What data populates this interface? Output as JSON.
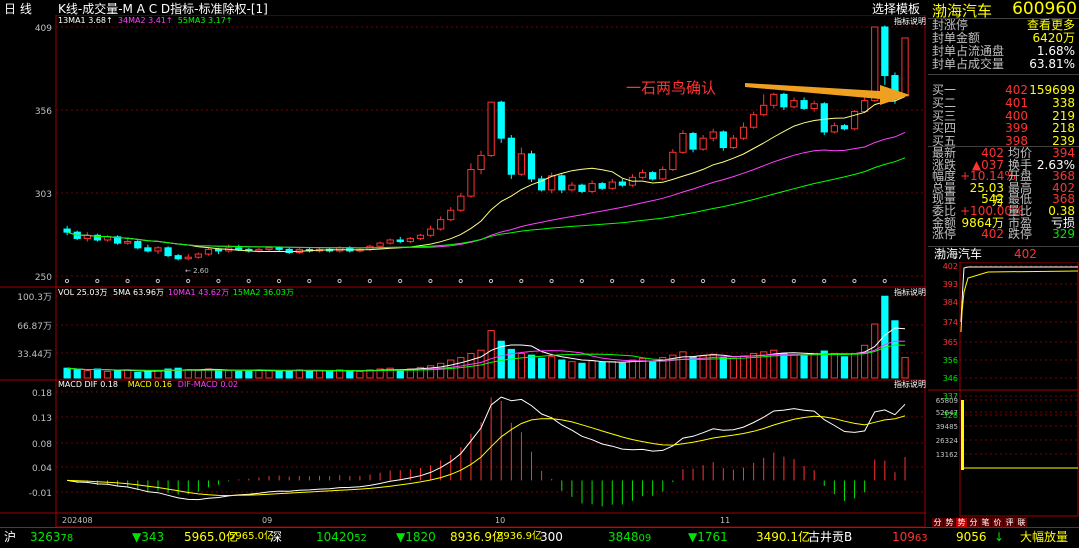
{
  "header": {
    "period": "日  线",
    "subtitle": "K线-成交量-M A C D指标-标准除权-[1]",
    "template_button": "选择模板"
  },
  "kline_panel": {
    "ma_legend": [
      {
        "label": "13MA1 3.68↑",
        "color": "#ffffff"
      },
      {
        "label": "34MA2 3.41↑",
        "color": "#ff40ff"
      },
      {
        "label": "55MA3 3.17↑",
        "color": "#00ff00"
      }
    ],
    "indicator_help": "指标说明",
    "y_labels": [
      "409",
      "356",
      "303",
      "250"
    ],
    "annotation": "一石两鸟确认",
    "low_label": "2.60"
  },
  "volume_panel": {
    "legend": [
      {
        "label": "VOL 25.03万",
        "color": "#ffffff"
      },
      {
        "label": "5MA 63.96万",
        "color": "#ffffff"
      },
      {
        "label": "10MA1 43.62万",
        "color": "#ff40ff"
      },
      {
        "label": "15MA2 36.03万",
        "color": "#00ff00"
      }
    ],
    "indicator_help": "指标说明",
    "y_labels": [
      "100.3万",
      "66.87万",
      "33.44万"
    ]
  },
  "macd_panel": {
    "legend": [
      {
        "label": "MACD DIF 0.18",
        "color": "#ffffff"
      },
      {
        "label": "MACD 0.16",
        "color": "#ffff00"
      },
      {
        "label": "DIF-MACD 0.02",
        "color": "#ff40ff"
      }
    ],
    "indicator_help": "指标说明",
    "y_labels": [
      "0.18",
      "0.13",
      "0.08",
      "0.04",
      "-0.01"
    ]
  },
  "x_axis": {
    "labels": [
      "202408",
      "09",
      "10",
      "11"
    ]
  },
  "quote": {
    "name": "渤海汽车",
    "code": "600960",
    "rows_top": [
      {
        "label": "封涨停",
        "value": "查看更多",
        "color": "#ffff00"
      },
      {
        "label": "封单金额",
        "value": "6420万",
        "color": "#ffff00"
      },
      {
        "label": "封单占流通盘",
        "value": "1.68%",
        "color": "#ffffff"
      },
      {
        "label": "封单占成交量",
        "value": "63.81%",
        "color": "#ffffff"
      }
    ],
    "order_book": [
      {
        "label": "买一",
        "price": "402",
        "qty": "159699"
      },
      {
        "label": "买二",
        "price": "401",
        "qty": "338"
      },
      {
        "label": "买三",
        "price": "400",
        "qty": "219"
      },
      {
        "label": "买四",
        "price": "399",
        "qty": "218"
      },
      {
        "label": "买五",
        "price": "398",
        "qty": "239"
      }
    ],
    "stats": [
      {
        "a": "最新",
        "b": "402",
        "bc": "#ff3232",
        "c": "均价",
        "d": "394",
        "dc": "#ff3232"
      },
      {
        "a": "涨跌",
        "b": "▲037",
        "bc": "#ff3232",
        "c": "换手",
        "d": "2.63%",
        "dc": "#ffffff"
      },
      {
        "a": "幅度",
        "b": "+10.14%",
        "bc": "#ff3232",
        "c": "开盘",
        "d": "368",
        "dc": "#ff3232"
      },
      {
        "a": "总量",
        "b": "25.03万",
        "bc": "#ffff00",
        "c": "最高",
        "d": "402",
        "dc": "#ff3232"
      },
      {
        "a": "现量",
        "b": "542",
        "bc": "#ffff00",
        "c": "最低",
        "d": "368",
        "dc": "#ff3232"
      },
      {
        "a": "委比",
        "b": "+100.00%",
        "bc": "#ff3232",
        "c": "量比",
        "d": "0.38",
        "dc": "#ffff00"
      },
      {
        "a": "金额",
        "b": "9864万",
        "bc": "#ffff00",
        "c": "市盈",
        "d": "亏损",
        "dc": "#ffffff"
      },
      {
        "a": "涨停",
        "b": "402",
        "bc": "#ff3232",
        "c": "跌停",
        "d": "329",
        "dc": "#00e600"
      }
    ],
    "mini_title": "渤海汽车",
    "mini_price": "402",
    "mini_y_labels": [
      "402",
      "393",
      "384",
      "374",
      "365",
      "356",
      "346",
      "337",
      "328"
    ],
    "mini_vol_labels": [
      "65809",
      "52647",
      "39485",
      "26324",
      "13162"
    ],
    "bottom_tabs": [
      "分",
      "势",
      "势",
      "分",
      "笔",
      "价",
      "评",
      "联"
    ]
  },
  "statusbar": {
    "sh_label": "沪",
    "sh_index": "3263",
    "sh_index_dec": "78",
    "sh_chg": "▼343",
    "sh_amount": "5965.0亿",
    "sh_amount2": "5965.0亿",
    "sz_label": "深",
    "sz_index": "10420",
    "sz_index_dec": "52",
    "sz_chg": "▼1820",
    "sz_amount": "8936.9亿",
    "sz_amount2": "8936.9亿",
    "cy_label": "300",
    "cy_index": "3848",
    "cy_index_dec": "09",
    "cy_chg": "▼1761",
    "cy_amount": "3490.1亿",
    "stock_name": "古井贡B",
    "stock_val": "109",
    "stock_val_dec": "63",
    "vol_now": "9056",
    "vol_arrow": "↓",
    "vol_label": "大幅放量"
  },
  "chart_data": {
    "type": "candlestick",
    "dates_label": [
      "202408",
      "09",
      "10",
      "11"
    ],
    "candles": [
      [
        2.8,
        2.78,
        2.82,
        2.76
      ],
      [
        2.78,
        2.74,
        2.79,
        2.73
      ],
      [
        2.74,
        2.76,
        2.78,
        2.72
      ],
      [
        2.76,
        2.73,
        2.77,
        2.72
      ],
      [
        2.73,
        2.75,
        2.76,
        2.72
      ],
      [
        2.75,
        2.71,
        2.76,
        2.7
      ],
      [
        2.71,
        2.72,
        2.74,
        2.7
      ],
      [
        2.72,
        2.68,
        2.73,
        2.67
      ],
      [
        2.68,
        2.66,
        2.7,
        2.65
      ],
      [
        2.66,
        2.68,
        2.69,
        2.64
      ],
      [
        2.68,
        2.63,
        2.69,
        2.62
      ],
      [
        2.63,
        2.61,
        2.64,
        2.6
      ],
      [
        2.61,
        2.62,
        2.64,
        2.6
      ],
      [
        2.62,
        2.64,
        2.65,
        2.61
      ],
      [
        2.64,
        2.67,
        2.68,
        2.63
      ],
      [
        2.67,
        2.66,
        2.68,
        2.64
      ],
      [
        2.66,
        2.68,
        2.7,
        2.65
      ],
      [
        2.68,
        2.67,
        2.7,
        2.66
      ],
      [
        2.67,
        2.66,
        2.68,
        2.65
      ],
      [
        2.66,
        2.67,
        2.68,
        2.65
      ],
      [
        2.67,
        2.68,
        2.69,
        2.66
      ],
      [
        2.68,
        2.67,
        2.69,
        2.66
      ],
      [
        2.67,
        2.65,
        2.68,
        2.64
      ],
      [
        2.65,
        2.67,
        2.68,
        2.64
      ],
      [
        2.67,
        2.66,
        2.68,
        2.65
      ],
      [
        2.66,
        2.67,
        2.68,
        2.65
      ],
      [
        2.67,
        2.66,
        2.68,
        2.65
      ],
      [
        2.66,
        2.68,
        2.69,
        2.65
      ],
      [
        2.68,
        2.66,
        2.69,
        2.65
      ],
      [
        2.66,
        2.67,
        2.68,
        2.65
      ],
      [
        2.67,
        2.69,
        2.7,
        2.66
      ],
      [
        2.69,
        2.71,
        2.72,
        2.68
      ],
      [
        2.71,
        2.73,
        2.74,
        2.7
      ],
      [
        2.73,
        2.72,
        2.75,
        2.71
      ],
      [
        2.72,
        2.74,
        2.75,
        2.71
      ],
      [
        2.74,
        2.76,
        2.77,
        2.73
      ],
      [
        2.76,
        2.8,
        2.82,
        2.75
      ],
      [
        2.8,
        2.86,
        2.88,
        2.79
      ],
      [
        2.86,
        2.92,
        2.94,
        2.85
      ],
      [
        2.92,
        3.01,
        3.03,
        2.91
      ],
      [
        3.01,
        3.18,
        3.22,
        3.0
      ],
      [
        3.18,
        3.27,
        3.3,
        3.15
      ],
      [
        3.27,
        3.61,
        3.61,
        3.26
      ],
      [
        3.61,
        3.38,
        3.62,
        3.35
      ],
      [
        3.38,
        3.15,
        3.4,
        3.12
      ],
      [
        3.15,
        3.28,
        3.32,
        3.14
      ],
      [
        3.28,
        3.12,
        3.3,
        3.1
      ],
      [
        3.12,
        3.05,
        3.14,
        3.04
      ],
      [
        3.05,
        3.14,
        3.16,
        3.03
      ],
      [
        3.14,
        3.05,
        3.15,
        3.03
      ],
      [
        3.05,
        3.08,
        3.1,
        3.04
      ],
      [
        3.08,
        3.04,
        3.09,
        3.03
      ],
      [
        3.04,
        3.09,
        3.11,
        3.03
      ],
      [
        3.09,
        3.06,
        3.1,
        3.05
      ],
      [
        3.06,
        3.1,
        3.12,
        3.05
      ],
      [
        3.1,
        3.08,
        3.12,
        3.07
      ],
      [
        3.08,
        3.13,
        3.15,
        3.07
      ],
      [
        3.13,
        3.16,
        3.18,
        3.12
      ],
      [
        3.16,
        3.12,
        3.17,
        3.11
      ],
      [
        3.12,
        3.18,
        3.2,
        3.11
      ],
      [
        3.18,
        3.29,
        3.31,
        3.17
      ],
      [
        3.29,
        3.41,
        3.43,
        3.28
      ],
      [
        3.41,
        3.31,
        3.42,
        3.29
      ],
      [
        3.31,
        3.38,
        3.4,
        3.3
      ],
      [
        3.38,
        3.42,
        3.44,
        3.36
      ],
      [
        3.42,
        3.32,
        3.43,
        3.3
      ],
      [
        3.32,
        3.38,
        3.4,
        3.31
      ],
      [
        3.38,
        3.45,
        3.48,
        3.37
      ],
      [
        3.45,
        3.53,
        3.55,
        3.44
      ],
      [
        3.53,
        3.59,
        3.66,
        3.52
      ],
      [
        3.59,
        3.66,
        3.67,
        3.57
      ],
      [
        3.66,
        3.58,
        3.67,
        3.56
      ],
      [
        3.58,
        3.62,
        3.64,
        3.57
      ],
      [
        3.62,
        3.57,
        3.64,
        3.56
      ],
      [
        3.57,
        3.6,
        3.62,
        3.55
      ],
      [
        3.6,
        3.42,
        3.61,
        3.4
      ],
      [
        3.42,
        3.46,
        3.48,
        3.41
      ],
      [
        3.46,
        3.44,
        3.47,
        3.43
      ],
      [
        3.44,
        3.55,
        3.56,
        3.43
      ],
      [
        3.55,
        3.62,
        3.64,
        3.54
      ],
      [
        3.62,
        4.09,
        4.09,
        3.61
      ],
      [
        4.09,
        3.78,
        4.1,
        3.72
      ],
      [
        3.78,
        3.64,
        3.8,
        3.6
      ],
      [
        3.65,
        4.02,
        4.02,
        3.68
      ]
    ],
    "volume_wan": [
      12,
      10,
      9,
      11,
      8,
      9,
      10,
      7,
      8,
      9,
      11,
      12,
      10,
      9,
      11,
      10,
      9,
      8,
      9,
      10,
      9,
      8,
      9,
      10,
      8,
      9,
      8,
      10,
      9,
      8,
      10,
      11,
      12,
      10,
      11,
      13,
      15,
      18,
      22,
      25,
      30,
      34,
      58,
      45,
      35,
      30,
      28,
      24,
      26,
      22,
      20,
      18,
      21,
      19,
      20,
      18,
      22,
      24,
      20,
      25,
      28,
      32,
      26,
      27,
      29,
      25,
      24,
      27,
      30,
      32,
      34,
      30,
      28,
      27,
      29,
      33,
      30,
      26,
      30,
      40,
      66,
      100,
      70,
      25
    ],
    "macd_dif": [
      0.0,
      -0.01,
      -0.02,
      -0.03,
      -0.03,
      -0.04,
      -0.04,
      -0.05,
      -0.05,
      -0.06
    ],
    "y_range_price": [
      2.5,
      4.09
    ],
    "y_range_vol": [
      0,
      100.3
    ],
    "y_range_macd": [
      -0.05,
      0.18
    ]
  }
}
